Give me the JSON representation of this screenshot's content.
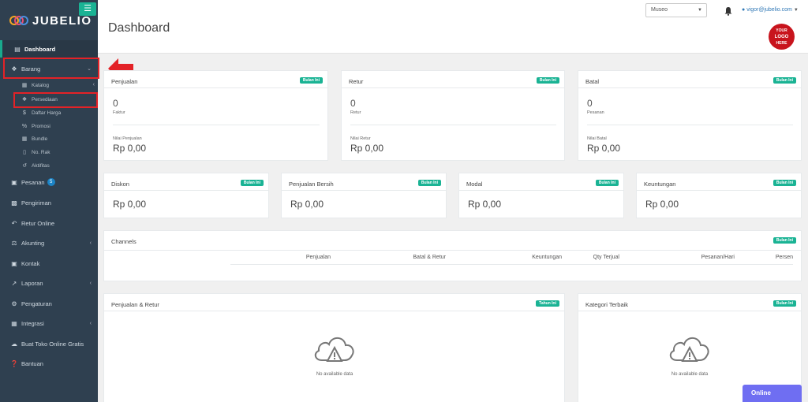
{
  "app": {
    "brand": "JUBELIO"
  },
  "colors": {
    "sidebar": "#2f4050",
    "accent": "#1ab394",
    "highlight": "#e32227",
    "online": "#6f6ef2"
  },
  "sidebar": {
    "toggle_icon": "hamburger-icon",
    "items": [
      {
        "label": "Dashboard",
        "icon": "area-chart-icon"
      },
      {
        "label": "Barang",
        "icon": "cubes-icon"
      },
      {
        "label": "Pesanan",
        "icon": "inbox-icon",
        "badge": "5"
      },
      {
        "label": "Pengiriman",
        "icon": "truck-icon"
      },
      {
        "label": "Retur Online",
        "icon": "reply-icon"
      },
      {
        "label": "Akunting",
        "icon": "balance-scale-icon"
      },
      {
        "label": "Kontak",
        "icon": "address-card-icon"
      },
      {
        "label": "Laporan",
        "icon": "line-chart-icon"
      },
      {
        "label": "Pengaturan",
        "icon": "gears-icon"
      },
      {
        "label": "Integrasi",
        "icon": "sitemap-icon"
      },
      {
        "label": "Buat Toko Online Gratis",
        "icon": "shopping-cart-icon"
      },
      {
        "label": "Bantuan",
        "icon": "question-circle-icon"
      }
    ],
    "subitems": [
      {
        "label": "Katalog",
        "icon": "table-icon"
      },
      {
        "label": "Persediaan",
        "icon": "cubes-icon"
      },
      {
        "label": "Daftar Harga",
        "icon": "dollar-icon"
      },
      {
        "label": "Promosi",
        "icon": "percent-icon"
      },
      {
        "label": "Bundle",
        "icon": "th-icon"
      },
      {
        "label": "No. Rak",
        "icon": "bookmark-icon"
      },
      {
        "label": "Aktifitas",
        "icon": "history-icon"
      }
    ]
  },
  "header": {
    "title": "Dashboard",
    "location_select": "Museo",
    "user_email": "vigor@jubelio.com",
    "logo_text": [
      "YOUR",
      "LOGO",
      "HERE"
    ]
  },
  "cards": {
    "penjualan": {
      "title": "Penjualan",
      "badge": "Bulan Ini",
      "count": "0",
      "count_label": "Faktur",
      "value_label": "Nilai Penjualan",
      "value": "Rp 0,00"
    },
    "retur": {
      "title": "Retur",
      "badge": "Bulan Ini",
      "count": "0",
      "count_label": "Retur",
      "value_label": "Nilai Retur",
      "value": "Rp 0,00"
    },
    "batal": {
      "title": "Batal",
      "badge": "Bulan Ini",
      "count": "0",
      "count_label": "Pesanan",
      "value_label": "Nilai Batal",
      "value": "Rp 0,00"
    },
    "diskon": {
      "title": "Diskon",
      "badge": "Bulan Ini",
      "value": "Rp 0,00"
    },
    "penjualan_bersih": {
      "title": "Penjualan Bersih",
      "badge": "Bulan Ini",
      "value": "Rp 0,00"
    },
    "modal": {
      "title": "Modal",
      "badge": "Bulan Ini",
      "value": "Rp 0,00"
    },
    "keuntungan": {
      "title": "Keuntungan",
      "badge": "Bulan Ini",
      "value": "Rp 0,00"
    }
  },
  "channels": {
    "title": "Channels",
    "badge": "Bulan Ini",
    "columns": [
      "Penjualan",
      "Batal & Retur",
      "Keuntungan",
      "Qty Terjual",
      "Pesanan/Hari",
      "Persen"
    ]
  },
  "penjualan_retur": {
    "title": "Penjualan & Retur",
    "badge": "Tahun Ini",
    "empty": "No available data"
  },
  "kategori": {
    "title": "Kategori Terbaik",
    "badge": "Bulan Ini",
    "empty": "No available data"
  },
  "online_button": "Online"
}
